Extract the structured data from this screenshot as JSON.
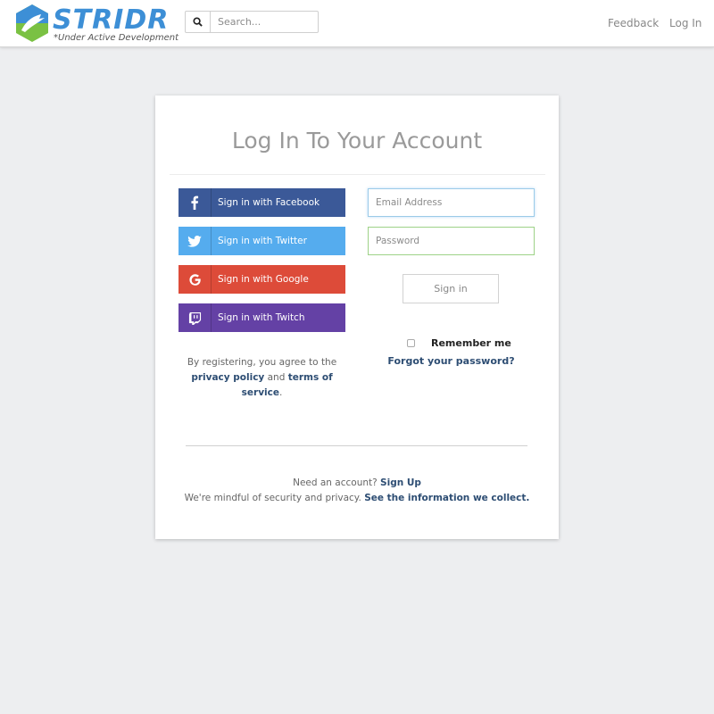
{
  "navbar": {
    "logo_text": "STRIDR",
    "logo_subtitle": "*Under Active Development",
    "search_placeholder": "Search...",
    "links": {
      "feedback": "Feedback",
      "login": "Log In"
    }
  },
  "login": {
    "title": "Log In To Your Account",
    "social": {
      "facebook": "Sign in with Facebook",
      "twitter": "Sign in with Twitter",
      "google": "Sign in with Google",
      "twitch": "Sign in with Twitch"
    },
    "terms": {
      "prefix": "By registering, you agree to the",
      "privacy": "privacy policy",
      "and": "and",
      "tos": "terms of service",
      "end": "."
    },
    "email_placeholder": "Email Address",
    "password_placeholder": "Password",
    "signin_label": "Sign in",
    "remember_label": "Remember me",
    "forgot_label": "Forgot your password?"
  },
  "footer": {
    "need_account": "Need an account?",
    "signup": "Sign Up",
    "privacy_text": "We're mindful of security and privacy.",
    "info_link": "See the information we collect."
  },
  "colors": {
    "facebook": "#3b5998",
    "twitter": "#55acee",
    "google": "#dd4b39",
    "twitch": "#6441a5",
    "logo_blue": "#3d8fd6",
    "logo_green": "#7ac143",
    "link": "#2d4d73"
  },
  "icons": {
    "search": "search-icon",
    "facebook": "facebook-icon",
    "twitter": "twitter-icon",
    "google": "google-icon",
    "twitch": "twitch-icon"
  }
}
